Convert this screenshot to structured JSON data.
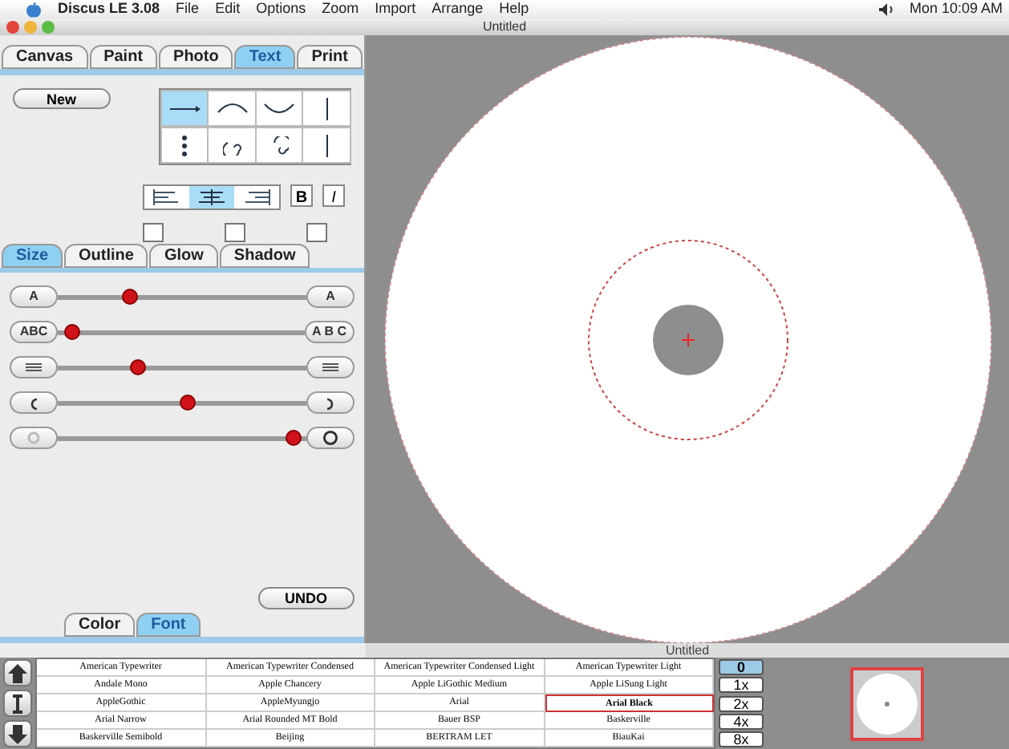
{
  "menu_bar": {
    "app": "Discus LE 3.08",
    "items": [
      "File",
      "Edit",
      "Options",
      "Zoom",
      "Import",
      "Arrange",
      "Help"
    ],
    "clock": "Mon 10:09 AM"
  },
  "window": {
    "title": "Untitled"
  },
  "main_tabs": [
    {
      "label": "Canvas",
      "selected": false
    },
    {
      "label": "Paint",
      "selected": false
    },
    {
      "label": "Photo",
      "selected": false
    },
    {
      "label": "Text",
      "selected": true
    },
    {
      "label": "Print",
      "selected": false
    }
  ],
  "new_button": "New",
  "text_styles": [
    {
      "kind": "straight",
      "selected": true
    },
    {
      "kind": "arc-up",
      "selected": false
    },
    {
      "kind": "arc-down",
      "selected": false
    },
    {
      "kind": "vertical",
      "selected": false
    },
    {
      "kind": "stacked",
      "selected": false
    },
    {
      "kind": "spiral-in",
      "selected": false
    },
    {
      "kind": "spiral-out",
      "selected": false
    },
    {
      "kind": "vertical-flip",
      "selected": false
    }
  ],
  "alignment": [
    {
      "kind": "left",
      "selected": false
    },
    {
      "kind": "center",
      "selected": true
    },
    {
      "kind": "right",
      "selected": false
    }
  ],
  "bold": {
    "label": "B",
    "on": false
  },
  "italic": {
    "label": "I",
    "on": false
  },
  "effect_checks": [
    {
      "checked": false
    },
    {
      "checked": false
    },
    {
      "checked": false
    }
  ],
  "effect_tabs": [
    {
      "label": "Size",
      "selected": true
    },
    {
      "label": "Outline",
      "selected": false
    },
    {
      "label": "Glow",
      "selected": false
    },
    {
      "label": "Shadow",
      "selected": false
    }
  ],
  "sliders": [
    {
      "kind": "size",
      "left": "A",
      "right": "A",
      "level": 0.29
    },
    {
      "kind": "spacing",
      "left": "ABC",
      "right": "A B C",
      "level": 0.06
    },
    {
      "kind": "lines",
      "level": 0.32
    },
    {
      "kind": "rotate",
      "level": 0.52
    },
    {
      "kind": "radius",
      "level": 0.95
    }
  ],
  "undo_button": "UNDO",
  "bottom_tabs": [
    {
      "label": "Color",
      "selected": false
    },
    {
      "label": "Font",
      "selected": true
    }
  ],
  "status_title": "Untitled",
  "fonts": [
    [
      {
        "name": "American Typewriter",
        "selected": false
      },
      {
        "name": "American Typewriter Condensed",
        "selected": false
      },
      {
        "name": "American Typewriter Condensed Light",
        "selected": false
      },
      {
        "name": "American Typewriter Light",
        "selected": false
      }
    ],
    [
      {
        "name": "Andale Mono",
        "selected": false
      },
      {
        "name": "Apple Chancery",
        "selected": false
      },
      {
        "name": "Apple LiGothic Medium",
        "selected": false
      },
      {
        "name": "Apple LiSung Light",
        "selected": false
      }
    ],
    [
      {
        "name": "AppleGothic",
        "selected": false
      },
      {
        "name": "AppleMyungjo",
        "selected": false
      },
      {
        "name": "Arial",
        "selected": false
      },
      {
        "name": "Arial Black",
        "selected": true
      }
    ],
    [
      {
        "name": "Arial Narrow",
        "selected": false
      },
      {
        "name": "Arial Rounded MT Bold",
        "selected": false
      },
      {
        "name": "Bauer BSP",
        "selected": false
      },
      {
        "name": "Baskerville",
        "selected": false
      }
    ],
    [
      {
        "name": "Baskerville Semibold",
        "selected": false
      },
      {
        "name": "Beijing",
        "selected": false
      },
      {
        "name": "BERTRAM LET",
        "selected": false
      },
      {
        "name": "BiauKai",
        "selected": false
      }
    ]
  ],
  "font_nav": [
    {
      "kind": "up"
    },
    {
      "kind": "text"
    },
    {
      "kind": "down"
    }
  ],
  "zoom_options": [
    {
      "label": "0",
      "selected": true
    },
    {
      "label": "1x",
      "selected": false
    },
    {
      "label": "2x",
      "selected": false
    },
    {
      "label": "4x",
      "selected": false
    },
    {
      "label": "8x",
      "selected": false
    }
  ]
}
